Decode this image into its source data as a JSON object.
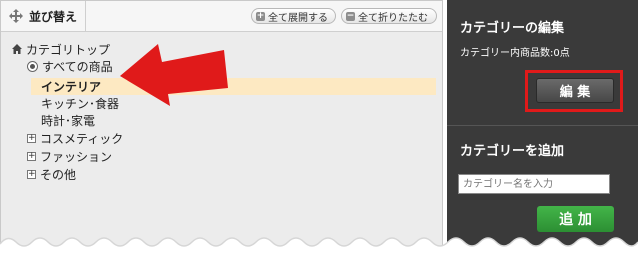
{
  "left_panel": {
    "sort_tab_label": "並び替え",
    "expand_all_label": "全て展開する",
    "collapse_all_label": "全て折りたたむ"
  },
  "tree": {
    "root": "カテゴリトップ",
    "all_products": "すべての商品",
    "items": [
      {
        "label": "インテリア",
        "selected": true
      },
      {
        "label": "キッチン･食器",
        "selected": false
      },
      {
        "label": "時計･家電",
        "selected": false
      },
      {
        "label": "コスメティック",
        "expandable": true
      },
      {
        "label": "ファッション",
        "expandable": true
      },
      {
        "label": "その他",
        "expandable": true
      }
    ]
  },
  "right_panel": {
    "edit_title": "カテゴリーの編集",
    "count_label": "カテゴリー内商品数:",
    "count_value": "0点",
    "edit_button": "編 集",
    "add_title": "カテゴリーを追加",
    "name_placeholder": "カテゴリー名を入力",
    "add_button": "追 加"
  },
  "colors": {
    "accent_red": "#e01a1a",
    "selected_bg": "#fde9c2",
    "add_green": "#2c8f33",
    "panel_dark": "#3a3a3a"
  },
  "icons": [
    "move-icon",
    "plus-icon",
    "minus-icon",
    "home-icon",
    "radio-icon",
    "expand-plus-icon",
    "red-arrow"
  ]
}
